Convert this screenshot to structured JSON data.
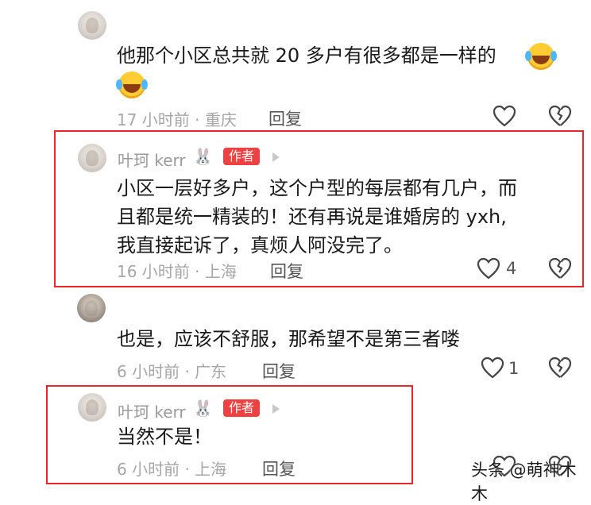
{
  "comments": [
    {
      "content_line1": "他那个小区总共就 20 多户有很多都是一样的",
      "meta": "17 小时前 · 重庆",
      "reply_label": "回复",
      "emoji": "laughing-crying-emoji"
    },
    {
      "username": "叶珂 kerr",
      "badge": "作者",
      "content_line1": "小区一层好多户，这个户型的每层都有几户，而",
      "content_line2": "且都是统一精装的！还有再说是谁婚房的 yxh,",
      "content_line3": "我直接起诉了，真烦人阿没完了。",
      "meta": "16 小时前 · 上海",
      "reply_label": "回复",
      "likes": "4"
    },
    {
      "content_line1": "也是，应该不舒服，那希望不是第三者喽",
      "meta": "6 小时前 · 广东",
      "reply_label": "回复",
      "likes": "1"
    },
    {
      "username": "叶珂 kerr",
      "badge": "作者",
      "content_line1": "当然不是！",
      "meta": "6 小时前 · 上海",
      "reply_label": "回复"
    }
  ],
  "watermark": "头条 @萌神木木",
  "colors": {
    "highlight_box": "#e8262b",
    "author_badge": "#f04142",
    "meta_text": "#a6a6a6"
  }
}
